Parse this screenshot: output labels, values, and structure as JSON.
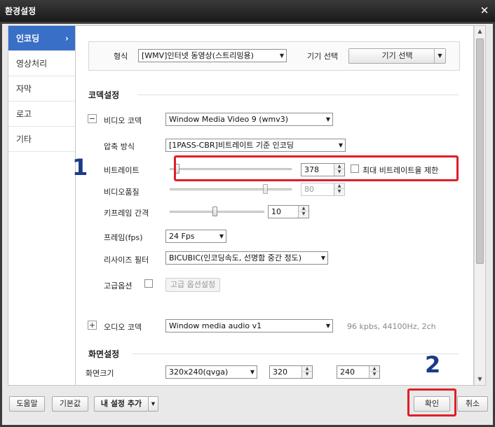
{
  "window": {
    "title": "환경설정",
    "close_glyph": "✕"
  },
  "sidebar": {
    "items": [
      {
        "label": "인코딩",
        "active": true,
        "chevron": "›"
      },
      {
        "label": "영상처리",
        "active": false
      },
      {
        "label": "자막",
        "active": false
      },
      {
        "label": "로고",
        "active": false
      },
      {
        "label": "기타",
        "active": false
      }
    ]
  },
  "format": {
    "label": "형식",
    "value": "[WMV]인터넷 동영상(스트리밍용)",
    "device_label": "기기 선택",
    "device_button": "기기 선택"
  },
  "codec": {
    "section_title": "코덱설정",
    "video": {
      "toggle": "−",
      "label": "비디오 코덱",
      "value": "Window Media Video 9 (wmv3)"
    },
    "compression": {
      "label": "압축 방식",
      "value": "[1PASS-CBR]비트레이트 기준 인코딩"
    },
    "bitrate": {
      "label": "비트레이트",
      "value": "378",
      "limit_label": "최대 비트레이트율 제한",
      "level": 0.06
    },
    "quality": {
      "label": "비디오품질",
      "value": "80",
      "level": 0.78
    },
    "keyframe": {
      "label": "키프레임 간격",
      "value": "10",
      "level": 0.48
    },
    "framerate": {
      "label": "프레임(fps)",
      "value": "24 Fps"
    },
    "resize": {
      "label": "리사이즈 필터",
      "value": "BICUBIC(인코딩속도, 선명함 중간 정도)"
    },
    "advanced": {
      "label": "고급옵션",
      "button": "고급 옵션설정"
    },
    "audio": {
      "toggle": "+",
      "label": "오디오 코덱",
      "value": "Window media audio v1",
      "info": "96 kpbs, 44100Hz, 2ch"
    }
  },
  "screen": {
    "section_title": "화면설정",
    "size_label": "화면크기",
    "size_value": "320x240(qvga)",
    "width": "320",
    "height": "240"
  },
  "footer": {
    "help": "도움말",
    "default": "기본값",
    "add_my_setting": "내 설정 추가",
    "ok": "확인",
    "cancel": "취소"
  },
  "annotations": {
    "one": "1",
    "two": "2"
  },
  "colors": {
    "accent": "#3a6fc8",
    "highlight": "#e01e27",
    "annotation_text": "#1a3a8c"
  }
}
